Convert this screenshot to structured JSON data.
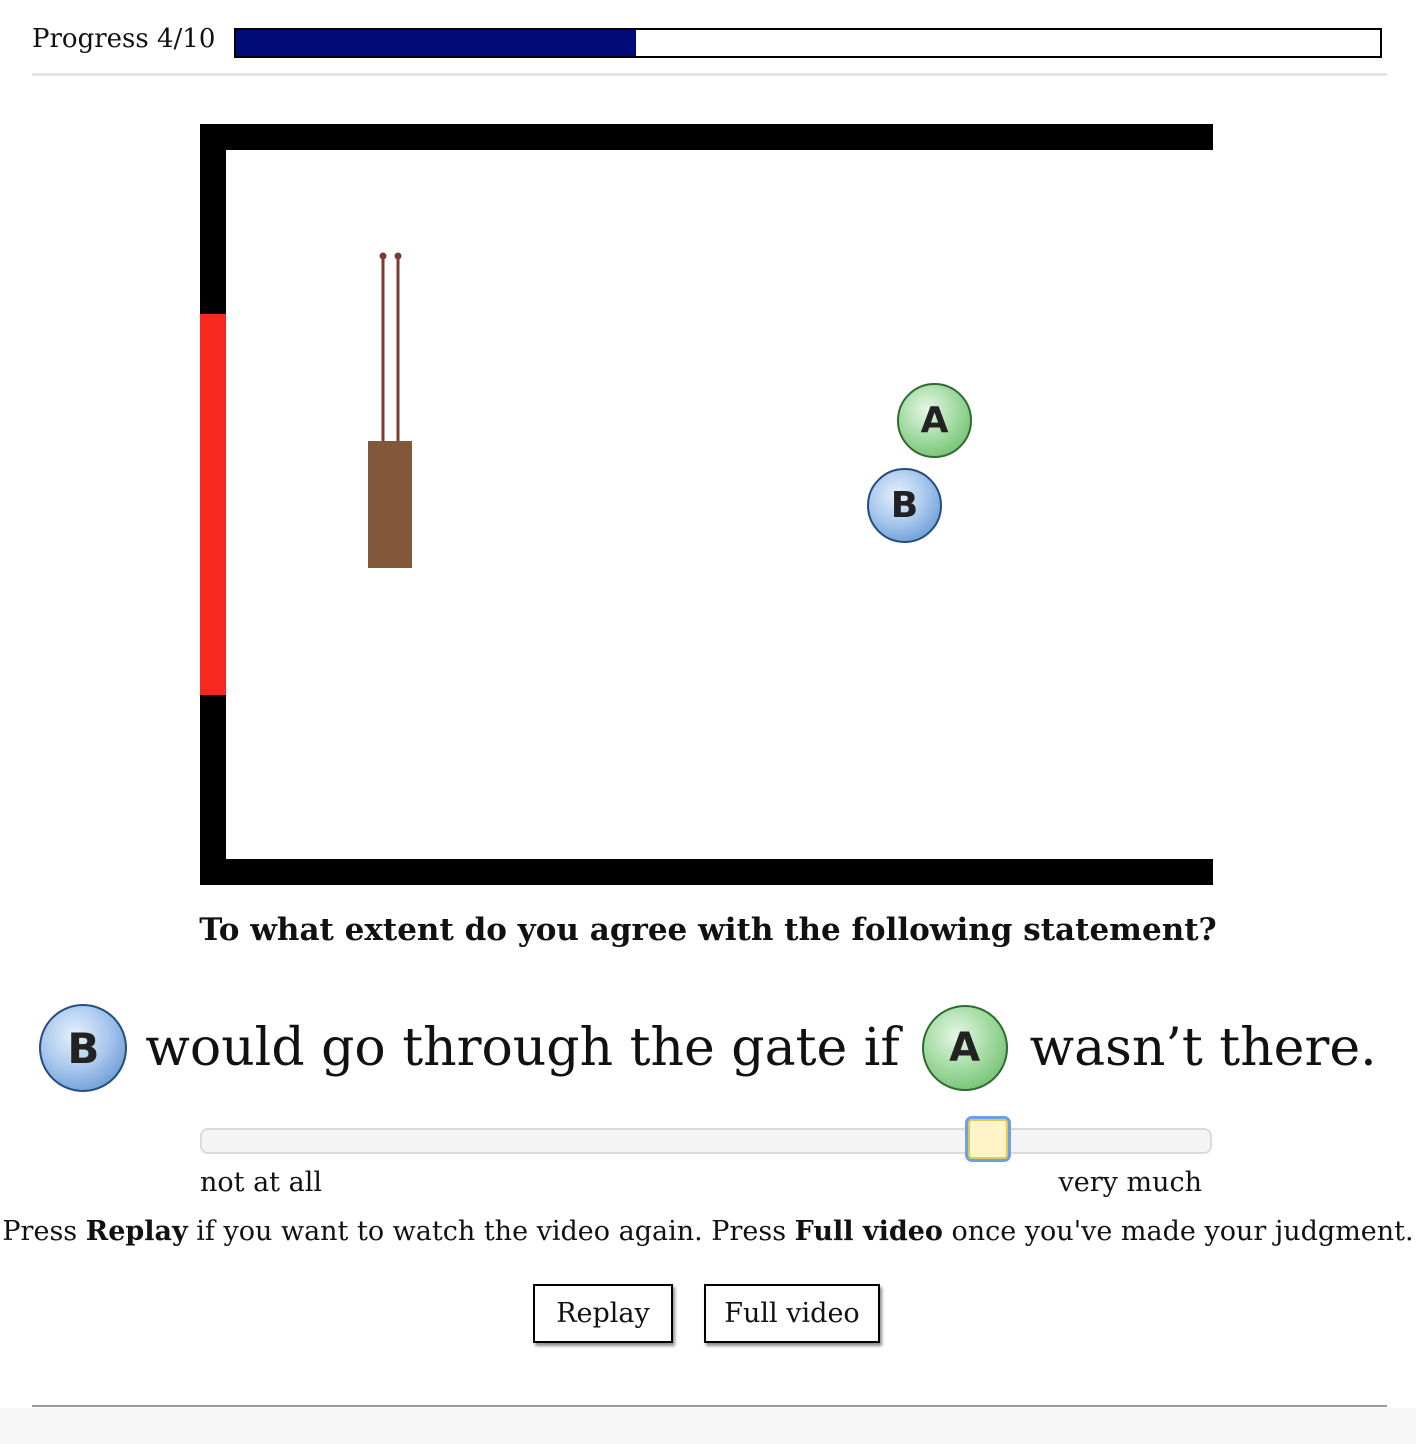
{
  "progress": {
    "label": "Progress 4/10",
    "fraction": 0.35,
    "fill_color": "#000b7a"
  },
  "scene": {
    "wall_color": "#000000",
    "gate_color": "#f7291e",
    "door_color": "#83573a",
    "door_pole_color": "#7a3b30",
    "balls": [
      {
        "label": "A",
        "color": "green"
      },
      {
        "label": "B",
        "color": "blue"
      }
    ]
  },
  "question": "To what extent do you agree with the following statement?",
  "statement": {
    "subject": "B",
    "part1": "would go through the gate if",
    "object": "A",
    "part2": "wasn’t there."
  },
  "slider": {
    "value": 0.78,
    "min_label": "not at all",
    "max_label": "very much"
  },
  "instructions": {
    "pre": "Press ",
    "replay_word": "Replay",
    "mid": " if you want to watch the video again. Press ",
    "full_word": "Full video",
    "post": " once you've made your judgment."
  },
  "buttons": {
    "replay": "Replay",
    "full_video": "Full video"
  }
}
